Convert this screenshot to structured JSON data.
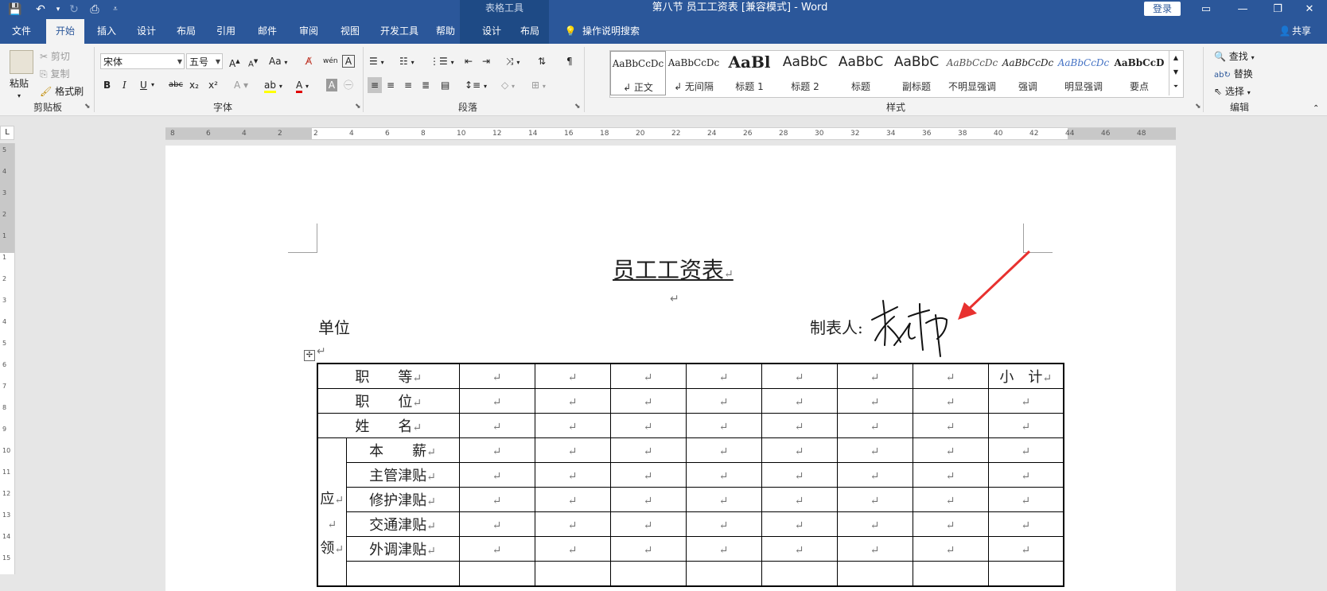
{
  "titlebar": {
    "context_tool": "表格工具",
    "title": "第八节 员工工资表 [兼容模式]  -  Word",
    "login": "登录"
  },
  "tabs": [
    "文件",
    "开始",
    "插入",
    "设计",
    "布局",
    "引用",
    "邮件",
    "审阅",
    "视图",
    "开发工具",
    "帮助",
    "设计",
    "布局"
  ],
  "tell_me": "操作说明搜索",
  "share": "共享",
  "clipboard": {
    "paste": "粘贴",
    "cut": "剪切",
    "copy": "复制",
    "format_painter": "格式刷",
    "label": "剪贴板"
  },
  "font": {
    "name": "宋体",
    "size": "五号",
    "label": "字体",
    "bold": "B",
    "italic": "I",
    "underline": "U",
    "strike": "abc",
    "sub": "x₂",
    "sup": "x²",
    "aa": "Aa"
  },
  "paragraph": {
    "label": "段落"
  },
  "styles": {
    "label": "样式",
    "items": [
      {
        "preview": "AaBbCcDc",
        "name": "↲ 正文"
      },
      {
        "preview": "AaBbCcDc",
        "name": "↲ 无间隔"
      },
      {
        "preview": "AaBl",
        "name": "标题 1"
      },
      {
        "preview": "AaBbC",
        "name": "标题 2"
      },
      {
        "preview": "AaBbC",
        "name": "标题"
      },
      {
        "preview": "AaBbC",
        "name": "副标题"
      },
      {
        "preview": "AaBbCcDc",
        "name": "不明显强调"
      },
      {
        "preview": "AaBbCcDc",
        "name": "强调"
      },
      {
        "preview": "AaBbCcDc",
        "name": "明显强调"
      },
      {
        "preview": "AaBbCcD",
        "name": "要点"
      }
    ]
  },
  "editing": {
    "find": "查找",
    "replace": "替换",
    "select": "选择",
    "label": "编辑"
  },
  "ruler_numbers": [
    "8",
    "6",
    "4",
    "2",
    "2",
    "4",
    "6",
    "8",
    "10",
    "12",
    "14",
    "16",
    "18",
    "20",
    "22",
    "24",
    "26",
    "28",
    "30",
    "32",
    "34",
    "36",
    "38",
    "40",
    "42",
    "44",
    "46",
    "48"
  ],
  "vruler_numbers": [
    "5",
    "4",
    "3",
    "2",
    "1",
    "1",
    "2",
    "3",
    "4",
    "5",
    "6",
    "7",
    "8",
    "9",
    "10",
    "11",
    "12",
    "13",
    "14",
    "15"
  ],
  "document": {
    "title": "员工工资表",
    "unit_label": "单位",
    "maker_label": "制表人:",
    "signature": "李纬",
    "para_mark": "↵",
    "rows": [
      {
        "label": "职　　等",
        "last": "小　计"
      },
      {
        "label": "职　　位",
        "last": ""
      },
      {
        "label": "姓　　名",
        "last": ""
      }
    ],
    "group_label_top": "应",
    "group_label_bottom": "领",
    "sub_rows": [
      "本　　薪",
      "主管津贴",
      "修护津贴",
      "交通津贴",
      "外调津贴"
    ]
  }
}
